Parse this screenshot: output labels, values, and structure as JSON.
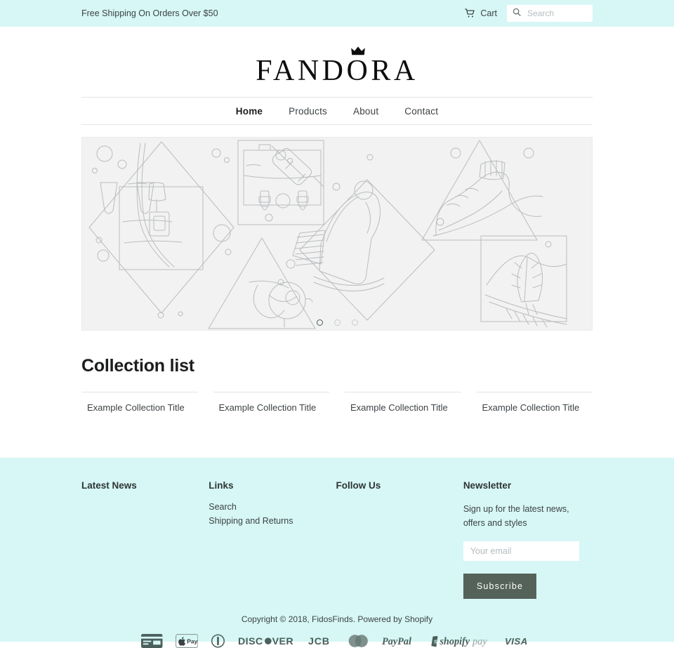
{
  "topbar": {
    "message": "Free Shipping On Orders Over $50",
    "cart_label": "Cart",
    "cart_icon": "shopping-cart-icon",
    "search_icon": "search-icon",
    "search_placeholder": "Search",
    "search_value": "",
    "background": "#d6f7f5"
  },
  "header": {
    "logo_text": "FANDORA",
    "logo_crown_icon": "crown-icon",
    "nav": [
      {
        "label": "Home",
        "active": true
      },
      {
        "label": "Products",
        "active": false
      },
      {
        "label": "About",
        "active": false
      },
      {
        "label": "Contact",
        "active": false
      }
    ]
  },
  "hero": {
    "placeholder_alt": "fashion-accessories-line-art-placeholder",
    "background": "#f2f2f2",
    "slides": 3,
    "active_slide": 1
  },
  "collections": {
    "title": "Collection list",
    "items": [
      {
        "label": "Example Collection Title"
      },
      {
        "label": "Example Collection Title"
      },
      {
        "label": "Example Collection Title"
      },
      {
        "label": "Example Collection Title"
      }
    ]
  },
  "footer": {
    "background": "#d6f7f5",
    "latest_news": {
      "heading": "Latest News"
    },
    "links": {
      "heading": "Links",
      "items": [
        {
          "label": "Search"
        },
        {
          "label": "Shipping and Returns"
        }
      ]
    },
    "follow_us": {
      "heading": "Follow Us"
    },
    "newsletter": {
      "heading": "Newsletter",
      "description": "Sign up for the latest news, offers and styles",
      "email_placeholder": "Your email",
      "email_value": "",
      "subscribe_label": "Subscribe",
      "button_color": "#546259"
    },
    "copyright": "Copyright © 2018, FidosFinds. Powered by Shopify",
    "payment_icons": [
      "american-express-icon",
      "apple-pay-icon",
      "diners-club-icon",
      "discover-icon",
      "jcb-icon",
      "mastercard-icon",
      "paypal-icon",
      "shopify-pay-icon",
      "visa-icon"
    ]
  }
}
